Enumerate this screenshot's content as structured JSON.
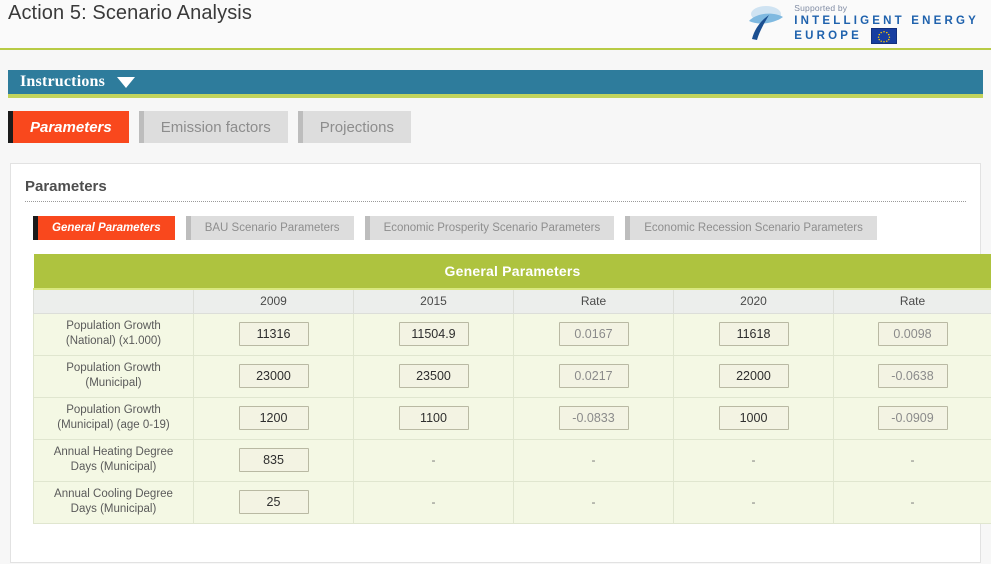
{
  "header": {
    "title": "Action 5: Scenario Analysis",
    "logo": {
      "supported_by": "Supported by",
      "line1": "INTELLIGENT ENERGY",
      "line2": "EUROPE",
      "mark_icon": "leaf-swoosh-icon",
      "flag_icon": "eu-flag-icon"
    },
    "accent_color": "#b8cb45"
  },
  "instructions": {
    "label": "Instructions",
    "toggle_icon": "chevron-down-icon",
    "bar_color": "#2e7c9c",
    "underline_color": "#c2d35c"
  },
  "main_tabs": [
    {
      "label": "Parameters",
      "active": true
    },
    {
      "label": "Emission factors",
      "active": false
    },
    {
      "label": "Projections",
      "active": false
    }
  ],
  "active_tab_color": "#f9481d",
  "card": {
    "heading": "Parameters"
  },
  "sub_tabs": [
    {
      "label": "General Parameters",
      "active": true
    },
    {
      "label": "BAU Scenario Parameters",
      "active": false
    },
    {
      "label": "Economic Prosperity Scenario Parameters",
      "active": false
    },
    {
      "label": "Economic Recession Scenario Parameters",
      "active": false
    }
  ],
  "table": {
    "band_title": "General Parameters",
    "band_color": "#aec33f",
    "columns": [
      "",
      "2009",
      "2015",
      "Rate",
      "2020",
      "Rate"
    ],
    "rows": [
      {
        "label_line1": "Population Growth",
        "label_line2": "(National) (x1.000)",
        "v2009": "11316",
        "v2015": "11504.9",
        "rate1": "0.0167",
        "v2020": "11618",
        "rate2": "0.0098",
        "type": "inputs"
      },
      {
        "label_line1": "Population Growth",
        "label_line2": "(Municipal)",
        "v2009": "23000",
        "v2015": "23500",
        "rate1": "0.0217",
        "v2020": "22000",
        "rate2": "-0.0638",
        "type": "inputs"
      },
      {
        "label_line1": "Population Growth",
        "label_line2": "(Municipal) (age 0-19)",
        "v2009": "1200",
        "v2015": "1100",
        "rate1": "-0.0833",
        "v2020": "1000",
        "rate2": "-0.0909",
        "type": "inputs"
      },
      {
        "label_line1": "Annual Heating Degree",
        "label_line2": "Days (Municipal)",
        "v2009": "835",
        "v2015": "-",
        "rate1": "-",
        "v2020": "-",
        "rate2": "-",
        "type": "single"
      },
      {
        "label_line1": "Annual Cooling Degree",
        "label_line2": "Days (Municipal)",
        "v2009": "25",
        "v2015": "-",
        "rate1": "-",
        "v2020": "-",
        "rate2": "-",
        "type": "single"
      }
    ]
  }
}
